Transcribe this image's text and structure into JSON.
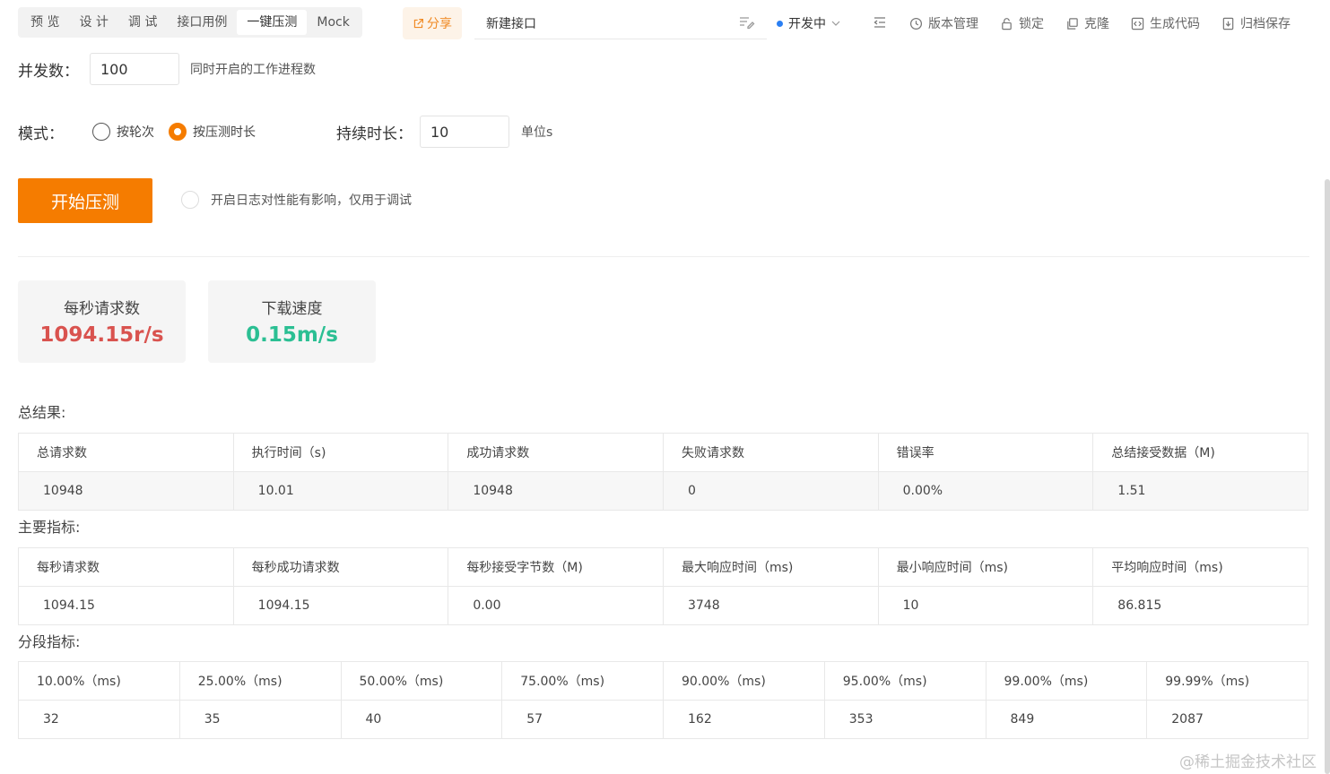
{
  "tabs": [
    {
      "label": "预 览",
      "active": false
    },
    {
      "label": "设 计",
      "active": false
    },
    {
      "label": "调 试",
      "active": false
    },
    {
      "label": "接口用例",
      "active": false
    },
    {
      "label": "一键压测",
      "active": true
    },
    {
      "label": "Mock",
      "active": false
    }
  ],
  "share_label": "分享",
  "api_name": "新建接口",
  "status": {
    "label": "开发中",
    "color": "#2a7ff3"
  },
  "actions": [
    {
      "label": "版本管理",
      "icon": "clock-icon"
    },
    {
      "label": "锁定",
      "icon": "lock-icon"
    },
    {
      "label": "克隆",
      "icon": "clone-icon"
    },
    {
      "label": "生成代码",
      "icon": "code-icon"
    },
    {
      "label": "归档保存",
      "icon": "archive-icon"
    }
  ],
  "concurrency": {
    "label": "并发数：",
    "value": "100",
    "hint": "同时开启的工作进程数"
  },
  "mode": {
    "label": "模式：",
    "options": [
      {
        "label": "按轮次",
        "selected": false
      },
      {
        "label": "按压测时长",
        "selected": true
      }
    ],
    "duration_label": "持续时长：",
    "duration_value": "10",
    "duration_unit": "单位s"
  },
  "start_button": "开始压测",
  "log_option": "开启日志对性能有影响，仅用于调试",
  "stats": [
    {
      "title": "每秒请求数",
      "value": "1094.15r/s",
      "color": "#d9534f"
    },
    {
      "title": "下载速度",
      "value": "0.15m/s",
      "color": "#2bbf93"
    }
  ],
  "summary": {
    "title": "总结果:",
    "headers": [
      "总请求数",
      "执行时间（s)",
      "成功请求数",
      "失败请求数",
      "错误率",
      "总结接受数据（M)"
    ],
    "values": [
      "10948",
      "10.01",
      "10948",
      "0",
      "0.00%",
      "1.51"
    ]
  },
  "main_metrics": {
    "title": "主要指标:",
    "headers": [
      "每秒请求数",
      "每秒成功请求数",
      "每秒接受字节数（M)",
      "最大响应时间（ms)",
      "最小响应时间（ms)",
      "平均响应时间（ms)"
    ],
    "values": [
      "1094.15",
      "1094.15",
      "0.00",
      "3748",
      "10",
      "86.815"
    ]
  },
  "segment_metrics": {
    "title": "分段指标:",
    "headers": [
      "10.00%（ms)",
      "25.00%（ms)",
      "50.00%（ms)",
      "75.00%（ms)",
      "90.00%（ms)",
      "95.00%（ms)",
      "99.00%（ms)",
      "99.99%（ms)"
    ],
    "values": [
      "32",
      "35",
      "40",
      "57",
      "162",
      "353",
      "849",
      "2087"
    ]
  },
  "watermark": "@稀土掘金技术社区",
  "accent_color": "#f57c00"
}
